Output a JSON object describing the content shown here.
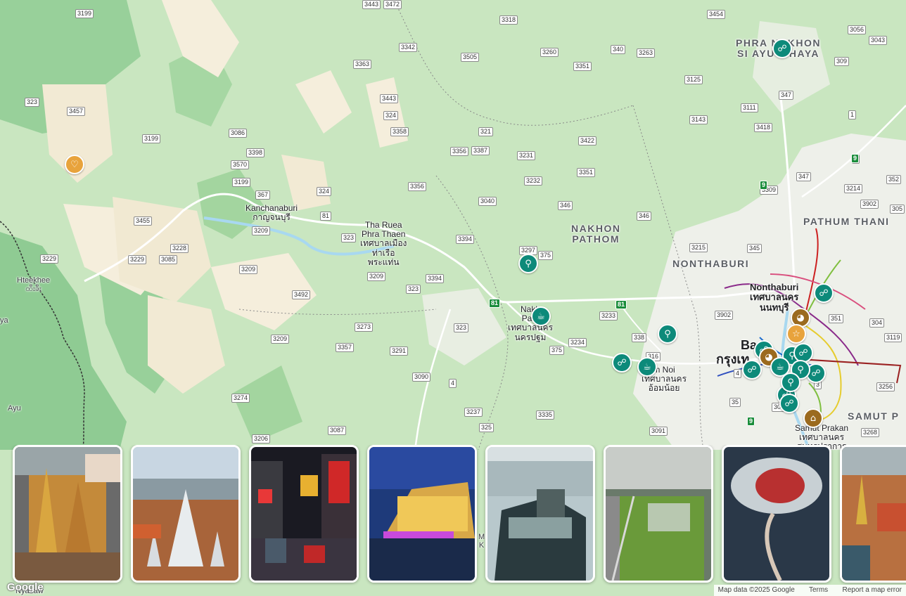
{
  "regions": [
    {
      "id": "phra-nakhon",
      "lines": [
        "PHRA NAKHON",
        "SI AYUTTHAYA"
      ]
    },
    {
      "id": "nakhon-pathom",
      "lines": [
        "NAKHON",
        "PATHOM"
      ]
    },
    {
      "id": "nonthaburi",
      "lines": [
        "NONTHABURI"
      ]
    },
    {
      "id": "pathum-thani",
      "lines": [
        "PATHUM THANI"
      ]
    },
    {
      "id": "samut-p",
      "lines": [
        "SAMUT P"
      ]
    }
  ],
  "cities": [
    {
      "id": "kanchanaburi",
      "lines": [
        "Kanchanaburi",
        "กาญจนบุรี"
      ]
    },
    {
      "id": "tha-ruea",
      "lines": [
        "Tha Ruea",
        "Phra Thaen",
        "เทศบาลเมือง",
        "ท่าเรือ",
        "พระแท่น"
      ]
    },
    {
      "id": "nakhon-pathom-city",
      "lines": [
        "Nakh",
        "Path",
        "เทศบาลนคร",
        "นครปฐม"
      ]
    },
    {
      "id": "nonthaburi-city",
      "lines": [
        "Nonthaburi",
        "เทศบาลนคร",
        "นนทบุรี"
      ]
    },
    {
      "id": "bangkok",
      "lines": [
        "Ba",
        "กรุงเท"
      ]
    },
    {
      "id": "om-noi",
      "lines": [
        "m Noi",
        "เทศบาลนคร",
        "อ้อมน้อย"
      ]
    },
    {
      "id": "samut-prakan",
      "lines": [
        "Samut Prakan",
        "เทศบาลนคร",
        "สมุทรปราการ"
      ]
    },
    {
      "id": "hteekhee",
      "lines": [
        "Hteekhee",
        "ထီးခီး"
      ]
    },
    {
      "id": "ya",
      "lines": [
        "ya"
      ]
    },
    {
      "id": "ayu",
      "lines": [
        "Ayu"
      ]
    },
    {
      "id": "nyabaw",
      "lines": [
        "Nyabaw"
      ]
    },
    {
      "id": "m-k",
      "lines": [
        "M",
        "K"
      ]
    }
  ],
  "road_shields": [
    "3199",
    "3443",
    "3472",
    "3318",
    "3454",
    "3056",
    "3043",
    "3342",
    "3505",
    "3260",
    "340",
    "3263",
    "3351",
    "309",
    "3363",
    "323",
    "3457",
    "3443",
    "324",
    "3358",
    "3086",
    "3199",
    "3398",
    "3570",
    "3199",
    "367",
    "324",
    "3356",
    "321",
    "3356",
    "3387",
    "3231",
    "3422",
    "3125",
    "347",
    "3111",
    "3418",
    "3143",
    "3232",
    "3351",
    "3040",
    "346",
    "346",
    "9",
    "3309",
    "347",
    "3214",
    "352",
    "3902",
    "305",
    "3455",
    "3228",
    "3209",
    "323",
    "3394",
    "3297",
    "375",
    "3215",
    "345",
    "3229",
    "3229",
    "3085",
    "3209",
    "3209",
    "3394",
    "3492",
    "323",
    "3902",
    "351",
    "304",
    "3119",
    "3273",
    "3357",
    "3291",
    "3209",
    "323",
    "338",
    "3233",
    "3234",
    "375",
    "316",
    "3090",
    "4",
    "3274",
    "3237",
    "325",
    "3335",
    "3087",
    "3206",
    "3091",
    "35",
    "303",
    "3",
    "4",
    "3256",
    "3268",
    "9",
    "1",
    "81",
    "81",
    "81",
    "9",
    "9",
    "9"
  ],
  "poi_icons": [
    "binoculars-icon",
    "heart-marker-icon",
    "restaurant-icon",
    "cafe-icon",
    "restaurant-icon",
    "binoculars-icon",
    "cafe-icon",
    "shopping-bag-icon",
    "binoculars-icon",
    "museum-icon",
    "star-marker-icon"
  ],
  "photo_cards": [
    {
      "subject": "Grand Palace temple complex aerial"
    },
    {
      "subject": "Wat Arun and Chao Phraya river"
    },
    {
      "subject": "Chinatown neon street at night"
    },
    {
      "subject": "Iconsiam riverside at dusk"
    },
    {
      "subject": "Rooftop skyscraper cityscape"
    },
    {
      "subject": "Benjakitti park aerial"
    },
    {
      "subject": "Lotus island temple with bridge"
    },
    {
      "subject": "Temple rooftops aerial"
    }
  ],
  "footer": {
    "logo": "Google",
    "map_data": "Map data ©2025 Google",
    "terms": "Terms",
    "report": "Report a map error"
  },
  "colors": {
    "pin_teal": "#0d8a7a",
    "pin_brown": "#9b6a1e",
    "pin_amber": "#e8a33c",
    "highway": "#1a8d3b"
  }
}
